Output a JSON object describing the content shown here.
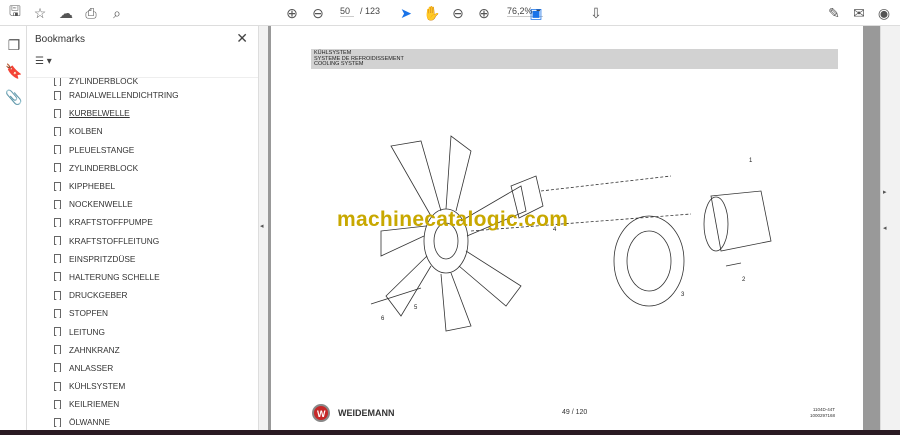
{
  "toolbar": {
    "page_current": "50",
    "page_total": "/ 123",
    "zoom": "76,2%"
  },
  "bookmarks": {
    "title": "Bookmarks",
    "items": [
      "ZYLINDERBLOCK",
      "RADIALWELLENDICHTRING",
      "KURBELWELLE",
      "KOLBEN",
      "PLEUELSTANGE",
      "ZYLINDERBLOCK",
      "KIPPHEBEL",
      "NOCKENWELLE",
      "KRAFTSTOFFPUMPE",
      "KRAFTSTOFFLEITUNG",
      "EINSPRITZDÜSE",
      "HALTERUNG SCHELLE",
      "DRUCKGEBER",
      "STOPFEN",
      "LEITUNG",
      "ZAHNKRANZ",
      "ANLASSER",
      "KÜHLSYSTEM",
      "KEILRIEMEN",
      "ÖLWANNE"
    ]
  },
  "page": {
    "header": [
      "KÜHLSYSTEM",
      "SYSTEME DE REFROIDISSEMENT",
      "COOLING SYSTEM"
    ],
    "watermark": "machinecatalogic.com",
    "callouts": [
      "1",
      "2",
      "3",
      "4",
      "5",
      "6"
    ],
    "brand": "WEIDEMANN",
    "page_label": "49 / 120",
    "doc_code": [
      "1104D-44T",
      "1000297168"
    ]
  },
  "colors": {
    "watermark": "#c8a800",
    "accent": "#1a73e8"
  }
}
